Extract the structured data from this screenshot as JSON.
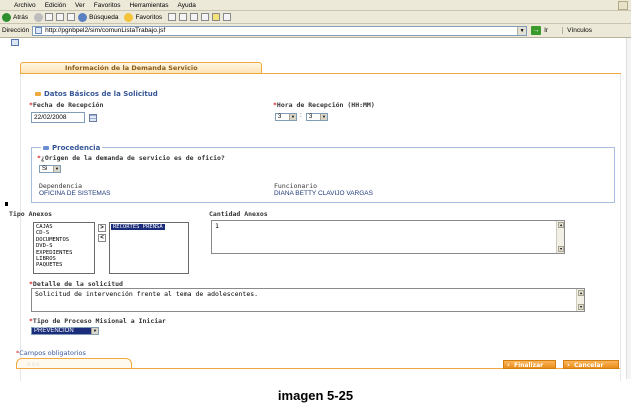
{
  "browser": {
    "menu": [
      "Archivo",
      "Edición",
      "Ver",
      "Favoritos",
      "Herramientas",
      "Ayuda"
    ],
    "toolbar": {
      "back": "Atrás",
      "search": "Búsqueda",
      "favorites": "Favoritos"
    },
    "address_label": "Dirección",
    "url": "http://pgnbpel2/sim/comunListaTrabajo.jsf",
    "go_label": "Ir",
    "links_label": "Vínculos"
  },
  "form": {
    "tab_title": "Información de la Demanda Servicio",
    "section_basic": "Datos Básicos de la Solicitud",
    "fecha_label": "Fecha de Recepción",
    "fecha_value": "22/02/2008",
    "hora_label": "Hora de Recepción (HH:MM)",
    "hora_hh": "3",
    "hora_sep": ":",
    "hora_mm": "3",
    "section_procedencia": "Procedencia",
    "origen_label": "¿Origen de la demanda de servicio es de oficio?",
    "origen_value": "Si",
    "dependencia_label": "Dependencia",
    "dependencia_value": "OFICINA DE SISTEMAS",
    "funcionario_label": "Funcionario",
    "funcionario_value": "DIANA BETTY CLAVIJO VARGAS",
    "tipo_anexos_label": "Tipo Anexos",
    "anexos_available": [
      "CAJAS",
      "CD-S",
      "DOCUMENTOS",
      "DVD-S",
      "EXPEDIENTES",
      "LIBROS",
      "PAQUETES"
    ],
    "anexos_selected": [
      "RECORTES PRENSA"
    ],
    "move_right": ">",
    "move_left": "<",
    "cantidad_label": "Cantidad Anexos",
    "cantidad_value": "1",
    "detalle_label": "Detalle de la solicitud",
    "detalle_value": "Solicitud de intervención frente al tema de adolescentes.",
    "tipo_proceso_label": "Tipo de Proceso Misional a Iniciar",
    "tipo_proceso_value": "PREVENCION",
    "required_marker": "*"
  },
  "footer": {
    "required_note": "Campos obligatorios",
    "finalizar": "Finalizar",
    "cancelar": "Cancelar"
  },
  "caption": "imagen 5-25",
  "colors": {
    "accent": "#f0a940",
    "section_blue": "#365796",
    "required": "#d42020"
  }
}
